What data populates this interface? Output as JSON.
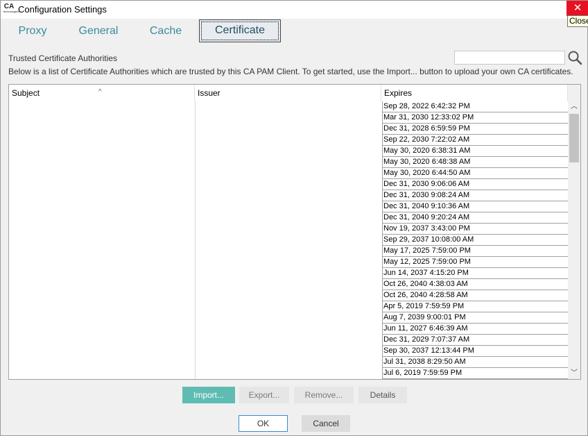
{
  "window": {
    "title": "Configuration Settings",
    "logo": "CA",
    "logo_sub": "technologies",
    "close_tooltip": "Close"
  },
  "tabs": [
    {
      "label": "Proxy",
      "active": false
    },
    {
      "label": "General",
      "active": false
    },
    {
      "label": "Cache",
      "active": false
    },
    {
      "label": "Certificate",
      "active": true
    }
  ],
  "certificate": {
    "section_label": "Trusted Certificate Authorities",
    "description": "Below is a list of Certificate Authorities which are trusted by this CA PAM Client. To get started, use the Import... button to upload your own CA certificates.",
    "search_value": "",
    "columns": [
      "Subject",
      "Issuer",
      "Expires"
    ],
    "rows": [
      {
        "subject": "",
        "issuer": "",
        "expires": "Sep 28, 2022 6:42:32 PM"
      },
      {
        "subject": "",
        "issuer": "",
        "expires": "Mar 31, 2030 12:33:02 PM"
      },
      {
        "subject": "",
        "issuer": "",
        "expires": "Dec 31, 2028 6:59:59 PM"
      },
      {
        "subject": "",
        "issuer": "",
        "expires": "Sep 22, 2030 7:22:02 AM"
      },
      {
        "subject": "",
        "issuer": "",
        "expires": "May 30, 2020 6:38:31 AM"
      },
      {
        "subject": "",
        "issuer": "",
        "expires": "May 30, 2020 6:48:38 AM"
      },
      {
        "subject": "",
        "issuer": "",
        "expires": "May 30, 2020 6:44:50 AM"
      },
      {
        "subject": "",
        "issuer": "",
        "expires": "Dec 31, 2030 9:06:06 AM"
      },
      {
        "subject": "",
        "issuer": "",
        "expires": "Dec 31, 2030 9:08:24 AM"
      },
      {
        "subject": "",
        "issuer": "",
        "expires": "Dec 31, 2040 9:10:36 AM"
      },
      {
        "subject": "",
        "issuer": "",
        "expires": "Dec 31, 2040 9:20:24 AM"
      },
      {
        "subject": "",
        "issuer": "",
        "expires": "Nov 19, 2037 3:43:00 PM"
      },
      {
        "subject": "",
        "issuer": "",
        "expires": "Sep 29, 2037 10:08:00 AM"
      },
      {
        "subject": "",
        "issuer": "",
        "expires": "May 17, 2025 7:59:00 PM"
      },
      {
        "subject": "",
        "issuer": "",
        "expires": "May 12, 2025 7:59:00 PM"
      },
      {
        "subject": "",
        "issuer": "",
        "expires": "Jun 14, 2037 4:15:20 PM"
      },
      {
        "subject": "",
        "issuer": "",
        "expires": "Oct 26, 2040 4:38:03 AM"
      },
      {
        "subject": "",
        "issuer": "",
        "expires": "Oct 26, 2040 4:28:58 AM"
      },
      {
        "subject": "",
        "issuer": "",
        "expires": "Apr 5, 2019 7:59:59 PM"
      },
      {
        "subject": "",
        "issuer": "",
        "expires": "Aug 7, 2039 9:00:01 PM"
      },
      {
        "subject": "",
        "issuer": "",
        "expires": "Jun 11, 2027 6:46:39 AM"
      },
      {
        "subject": "",
        "issuer": "",
        "expires": "Dec 31, 2029 7:07:37 AM"
      },
      {
        "subject": "",
        "issuer": "",
        "expires": "Sep 30, 2037 12:13:44 PM"
      },
      {
        "subject": "",
        "issuer": "",
        "expires": "Jul 31, 2038 8:29:50 AM"
      },
      {
        "subject": "",
        "issuer": "",
        "expires": "Jul 6, 2019 7:59:59 PM"
      }
    ],
    "buttons": {
      "import": "Import...",
      "export": "Export...",
      "remove": "Remove...",
      "details": "Details"
    }
  },
  "footer": {
    "ok": "OK",
    "cancel": "Cancel"
  },
  "icons": {
    "search": "search-icon",
    "close": "close-icon",
    "sort": "sort-ascending-icon",
    "scroll_up": "chevron-up-icon",
    "scroll_down": "chevron-down-icon"
  },
  "colors": {
    "accent": "#5fbcb2",
    "tab_text": "#3a8a9e",
    "close_red": "#e81123",
    "ok_border": "#3a8ad6"
  }
}
